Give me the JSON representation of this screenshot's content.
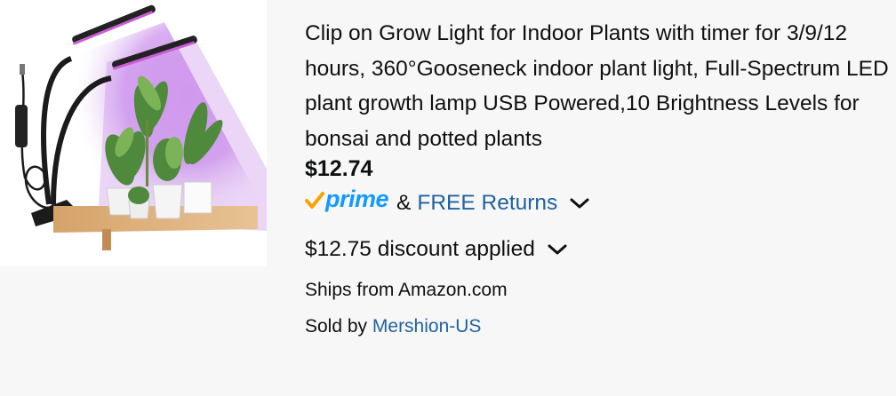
{
  "product": {
    "title": "Clip on Grow Light for Indoor Plants with timer for 3/9/12 hours, 360°Gooseneck indoor plant light, Full-Spectrum LED plant growth lamp USB Powered,10 Brightness Levels for bonsai and potted plants",
    "price": "$12.74",
    "prime_label": "prime",
    "amp": "&",
    "free_returns": "FREE Returns",
    "discount": "$12.75 discount applied",
    "ships_from": "Ships from Amazon.com",
    "sold_by_prefix": "Sold by",
    "seller": "Mershion-US"
  },
  "colors": {
    "link": "#2162a1",
    "prime_blue": "#1399ff",
    "prime_check": "#f7a300",
    "text": "#0f1111",
    "background": "#f7f7f7"
  },
  "icons": [
    "prime-check-icon",
    "chevron-down-icon"
  ]
}
